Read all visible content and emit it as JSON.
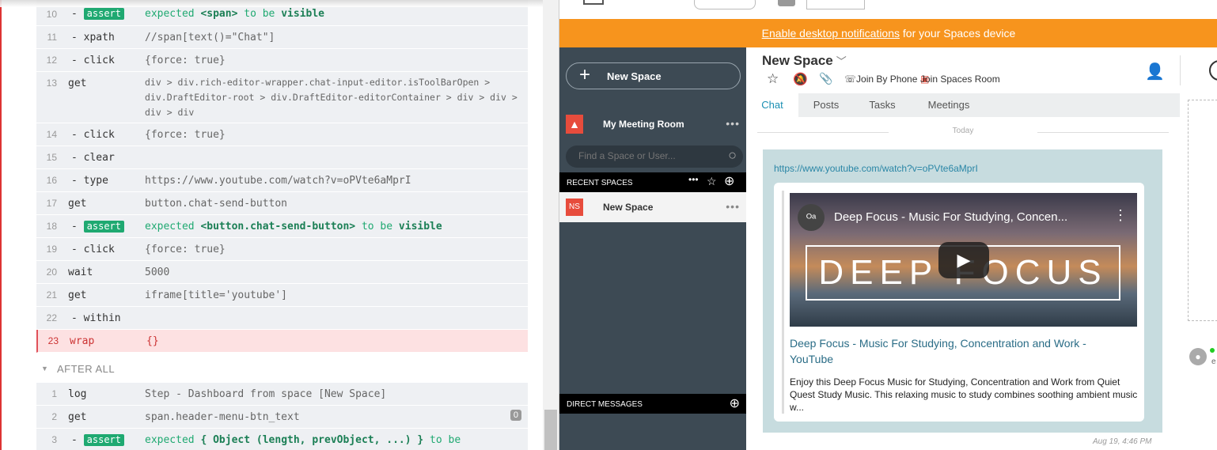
{
  "runner": {
    "commands": [
      {
        "num": "10",
        "name": "- assert",
        "badge": true,
        "msg_html": "<span class=\"kw\">expected</span> <span class=\"b\">&lt;span&gt;</span> <span class=\"kw\">to be</span> <span class=\"b\">visible</span>"
      },
      {
        "num": "11",
        "name": "- xpath",
        "msg": "//span[text()=\"Chat\"]"
      },
      {
        "num": "12",
        "name": "- click",
        "msg": "{force: true}"
      },
      {
        "num": "13",
        "name": "get",
        "msg": "div > div.rich-editor-wrapper.chat-input-editor.isToolBarOpen > div.DraftEditor-root > div.DraftEditor-editorContainer > div > div > div > div"
      },
      {
        "num": "14",
        "name": "- click",
        "msg": "{force: true}"
      },
      {
        "num": "15",
        "name": "- clear",
        "msg": ""
      },
      {
        "num": "16",
        "name": "- type",
        "msg": "https://www.youtube.com/watch?v=oPVte6aMprI"
      },
      {
        "num": "17",
        "name": "get",
        "msg": "button.chat-send-button"
      },
      {
        "num": "18",
        "name": "- assert",
        "badge": true,
        "msg_html": "<span class=\"kw\">expected</span> <span class=\"b\">&lt;button.chat-send-button&gt;</span> <span class=\"kw\">to be</span> <span class=\"b\">visible</span>"
      },
      {
        "num": "19",
        "name": "- click",
        "msg": "{force: true}"
      },
      {
        "num": "20",
        "name": "wait",
        "msg": "5000"
      },
      {
        "num": "21",
        "name": "get",
        "msg": "iframe[title='youtube']"
      },
      {
        "num": "22",
        "name": "- within",
        "msg": ""
      },
      {
        "num": "23",
        "name": "wrap",
        "msg": "{}",
        "fail": true
      }
    ],
    "after_all_label": "AFTER ALL",
    "after_commands": [
      {
        "num": "1",
        "name": "log",
        "msg": "Step - Dashboard from space [New Space]"
      },
      {
        "num": "2",
        "name": "get",
        "msg": "span.header-menu-btn_text",
        "pill": "0"
      },
      {
        "num": "3",
        "name": "- assert",
        "badge": true,
        "msg_html": "<span class=\"kw\">expected</span> <span class=\"b\">{ Object (length, prevObject, ...) }</span> <span class=\"kw\">to be</span>"
      }
    ]
  },
  "app": {
    "banner_link": "Enable desktop notifications",
    "banner_rest": " for your Spaces device",
    "new_space_button": "New Space",
    "meeting_room": "My Meeting Room",
    "search_placeholder": "Find a Space or User...",
    "recent_spaces": "RECENT SPACES",
    "space_badge": "NS",
    "space_name": "New Space",
    "direct_messages": "DIRECT MESSAGES",
    "space_title": "New Space",
    "join_phone": "Join By Phone",
    "join_room": "Join Spaces Room",
    "tabs": [
      "Chat",
      "Posts",
      "Tasks",
      "Meetings"
    ],
    "today": "Today",
    "link": "https://www.youtube.com/watch?v=oPVte6aMprI",
    "video_title": "Deep Focus - Music For Studying, Concen...",
    "video_overlay": "DEEP FOCUS",
    "card_title": "Deep Focus - Music For Studying, Concentration and Work - YouTube",
    "card_desc": "Enjoy this Deep Focus Music for Studying, Concentration and Work from Quiet Quest Study Music. This relaxing music to study combines soothing ambient music w...",
    "timestamp": "Aug 19, 4:46 PM",
    "presence_letter": "e"
  },
  "colors": {
    "accent": "#1a8fb3",
    "banner": "#f7941d",
    "pass": "#1fa971",
    "fail": "#e0515a",
    "sidebar": "#3d4a54"
  }
}
